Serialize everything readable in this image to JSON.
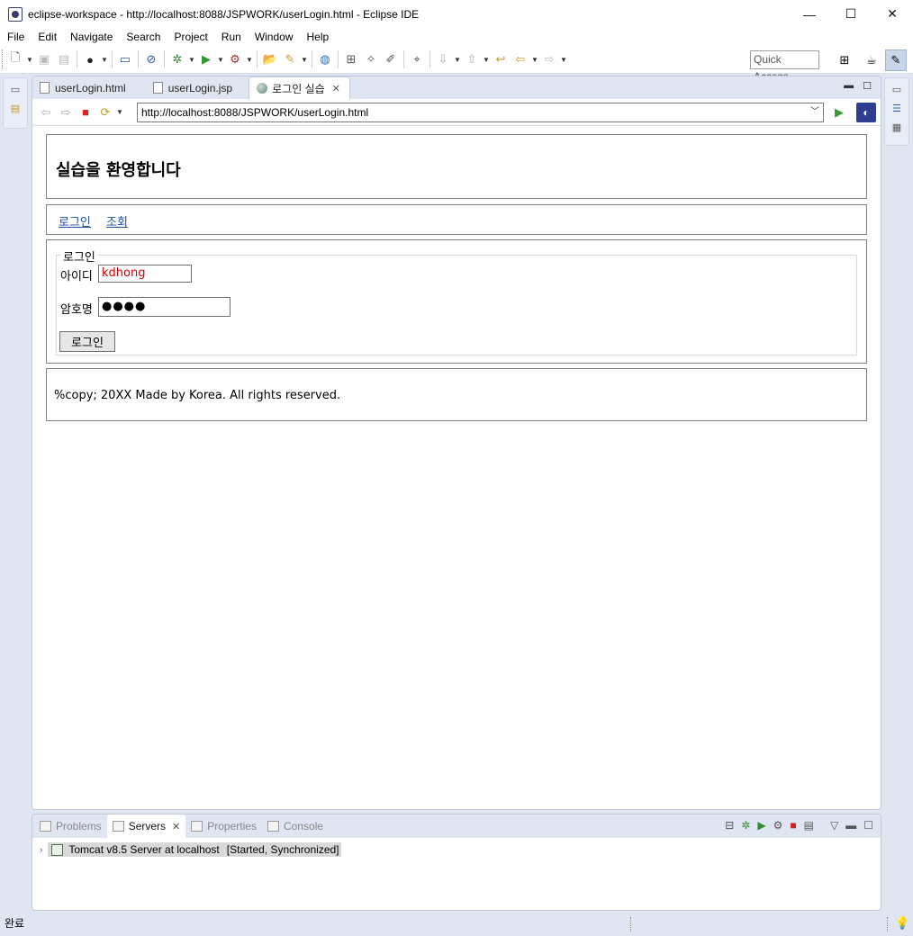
{
  "window": {
    "title": "eclipse-workspace - http://localhost:8088/JSPWORK/userLogin.html - Eclipse IDE",
    "minimize": "—",
    "maximize": "☐",
    "close": "✕"
  },
  "menu": [
    "File",
    "Edit",
    "Navigate",
    "Search",
    "Project",
    "Run",
    "Window",
    "Help"
  ],
  "toolbar": {
    "quick_access": "Quick Access"
  },
  "editor": {
    "tabs": [
      {
        "label": "userLogin.html"
      },
      {
        "label": "userLogin.jsp"
      },
      {
        "label": "로그인 실습"
      }
    ]
  },
  "browser": {
    "url": "http://localhost:8088/JSPWORK/userLogin.html"
  },
  "page": {
    "heading": "실습을 환영합니다",
    "nav_links": [
      "로그인",
      "조회"
    ],
    "legend": "로그인",
    "id_label": "아이디",
    "id_value": "kdhong",
    "pw_label": "암호명",
    "pw_value": "●●●●",
    "login_button": "로그인",
    "footer": "%copy; 20XX Made by Korea. All rights reserved."
  },
  "panel": {
    "tabs": [
      {
        "label": "Problems"
      },
      {
        "label": "Servers"
      },
      {
        "label": "Properties"
      },
      {
        "label": "Console"
      }
    ],
    "server_name": "Tomcat v8.5 Server at localhost",
    "server_status": "[Started, Synchronized]"
  },
  "status": {
    "text": "완료"
  }
}
